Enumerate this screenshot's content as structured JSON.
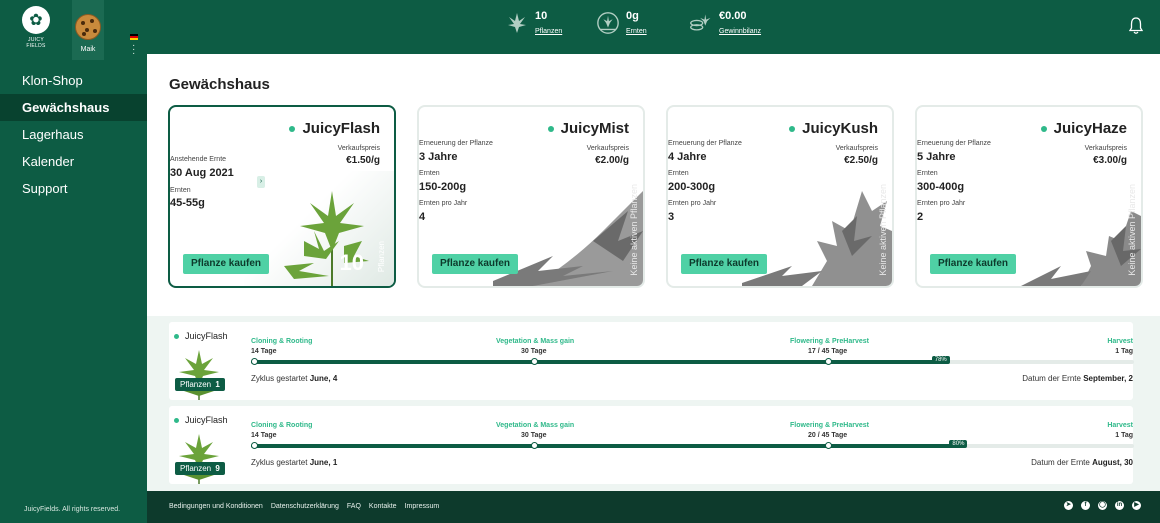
{
  "brand": {
    "logo_text": "JUICY FIELDS"
  },
  "user": {
    "name": "Maik"
  },
  "nav": [
    {
      "label": "Klon-Shop"
    },
    {
      "label": "Gewächshaus"
    },
    {
      "label": "Lagerhaus"
    },
    {
      "label": "Kalender"
    },
    {
      "label": "Support"
    }
  ],
  "copyright": "JuicyFields. All rights reserved.",
  "stats": {
    "plants": {
      "value": "10",
      "label": "Pflanzen"
    },
    "harvests": {
      "value": "0g",
      "label": "Ernten"
    },
    "profit": {
      "value": "€0.00",
      "label": "Gewinnbilanz"
    }
  },
  "page_title": "Gewächshaus",
  "cards": [
    {
      "name": "JuicyFlash",
      "price_label": "Verkaufspreis",
      "price": "€1.50/g",
      "row1_label": "Anstehende Ernte",
      "row1_value": "30 Aug 2021",
      "row2_label": "Ernten",
      "row2_value": "45-55g",
      "buy": "Pflanze kaufen",
      "count": "10",
      "count_label": "Pflanzen"
    },
    {
      "name": "JuicyMist",
      "price_label": "Verkaufspreis",
      "price": "€2.00/g",
      "row1_label": "Erneuerung der Pflanze",
      "row1_value": "3 Jahre",
      "row2_label": "Ernten",
      "row2_value": "150-200g",
      "row3_label": "Ernten pro Jahr",
      "row3_value": "4",
      "buy": "Pflanze kaufen",
      "vertical": "Keine aktiven Pflanzen"
    },
    {
      "name": "JuicyKush",
      "price_label": "Verkaufspreis",
      "price": "€2.50/g",
      "row1_label": "Erneuerung der Pflanze",
      "row1_value": "4 Jahre",
      "row2_label": "Ernten",
      "row2_value": "200-300g",
      "row3_label": "Ernten pro Jahr",
      "row3_value": "3",
      "buy": "Pflanze kaufen",
      "vertical": "Keine aktiven Pflanzen"
    },
    {
      "name": "JuicyHaze",
      "price_label": "Verkaufspreis",
      "price": "€3.00/g",
      "row1_label": "Erneuerung der Pflanze",
      "row1_value": "5 Jahre",
      "row2_label": "Ernten",
      "row2_value": "300-400g",
      "row3_label": "Ernten pro Jahr",
      "row3_value": "2",
      "buy": "Pflanze kaufen",
      "vertical": "Keine aktiven Pflanzen"
    }
  ],
  "cycles": [
    {
      "plant": "JuicyFlash",
      "plants_label": "Pflanzen",
      "plants_count": "1",
      "phases": [
        {
          "name": "Cloning & Rooting",
          "days": "14 Tage"
        },
        {
          "name": "Vegetation & Mass gain",
          "days": "30 Tage"
        },
        {
          "name": "Flowering & PreHarvest",
          "days": "17 / 45 Tage"
        },
        {
          "name": "Harvest",
          "days": "1 Tag"
        }
      ],
      "progress": 0.78,
      "progress_label": "78%",
      "started_label": "Zyklus gestartet",
      "started_value": "June, 4",
      "harvest_label": "Datum der Ernte",
      "harvest_value": "September, 2"
    },
    {
      "plant": "JuicyFlash",
      "plants_label": "Pflanzen",
      "plants_count": "9",
      "phases": [
        {
          "name": "Cloning & Rooting",
          "days": "14 Tage"
        },
        {
          "name": "Vegetation & Mass gain",
          "days": "30 Tage"
        },
        {
          "name": "Flowering & PreHarvest",
          "days": "20 / 45 Tage"
        },
        {
          "name": "Harvest",
          "days": "1 Tag"
        }
      ],
      "progress": 0.8,
      "progress_label": "80%",
      "started_label": "Zyklus gestartet",
      "started_value": "June, 1",
      "harvest_label": "Datum der Ernte",
      "harvest_value": "August, 30"
    }
  ],
  "footer": {
    "links": [
      "Bedingungen und Konditionen",
      "Datenschutzerklärung",
      "FAQ",
      "Kontakte",
      "Impressum"
    ],
    "social": [
      "telegram-icon",
      "facebook-icon",
      "instagram-icon",
      "linkedin-icon",
      "youtube-icon"
    ]
  },
  "colors": {
    "brand": "#0d5c44",
    "accent": "#4fd1a5",
    "dark": "#0d3a2c"
  }
}
